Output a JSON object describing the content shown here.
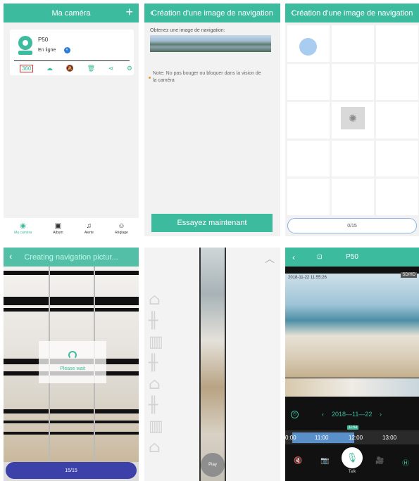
{
  "panel1": {
    "title": "Ma caméra",
    "plus": "+",
    "device_name": "P50",
    "device_status": "En ligne",
    "btn360": "360",
    "tabs": [
      {
        "label": "Ma caméra",
        "icon": "camera-icon"
      },
      {
        "label": "Album",
        "icon": "album-icon"
      },
      {
        "label": "Alerte",
        "icon": "bell-icon"
      },
      {
        "label": "Réglage",
        "icon": "user-icon"
      }
    ]
  },
  "panel2": {
    "title": "Création d'une image de navigation",
    "label": "Obtenez une image de navigation:",
    "note": "Note: No pas bouger ou bloquer dans la vision de la caméra",
    "button": "Essayez maintenant"
  },
  "panel3": {
    "title": "Création d'une image de navigation",
    "progress": "0/15"
  },
  "panel4": {
    "title": "Creating navigation pictur...",
    "wait": "Please wait",
    "progress": "15/15"
  },
  "panel5": {
    "play": "Play"
  },
  "panel6": {
    "title": "P50",
    "timestamp": "2018-11-22 11:55:26",
    "quality": "SD/HD",
    "date": "2018—11—22",
    "cursor_time": "11:54",
    "ticks": [
      "0:00",
      "11:00",
      "12:00",
      "13:00"
    ],
    "talk": "Talk"
  },
  "colors": {
    "accent": "#3dbb9e",
    "pill_blue": "#3b41a8"
  }
}
